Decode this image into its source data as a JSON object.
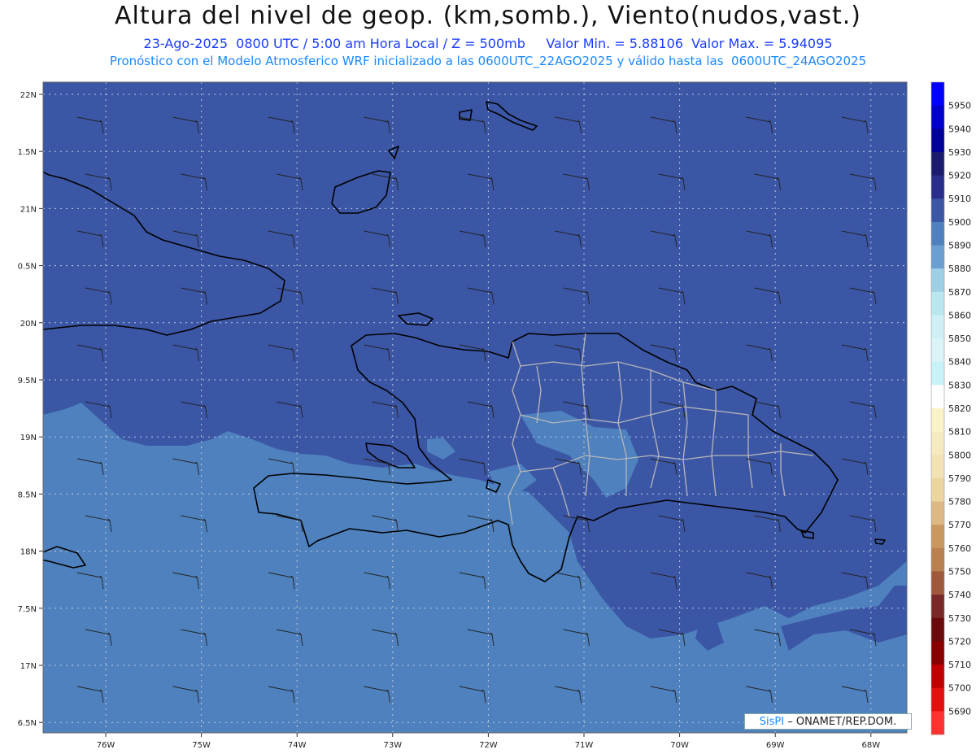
{
  "header": {
    "title": "Altura del nivel de geop. (km,somb.), Viento(nudos,vast.)",
    "date_line": "23-Ago-2025  0800 UTC / 5:00 am Hora Local / Z = 500mb     Valor Min. = 5.88106  Valor Max. = 5.94095",
    "model_line": "Pronóstico con el Modelo Atmosferico WRF inicializado a las 0600UTC_22AGO2025 y válido hasta las  0600UTC_24AGO2025"
  },
  "map": {
    "lat_labels": [
      "22N",
      "1.5N",
      "21N",
      "0.5N",
      "20N",
      "9.5N",
      "19N",
      "8.5N",
      "18N",
      "7.5N",
      "17N",
      "6.5N"
    ],
    "lon_labels": [
      "76W",
      "75W",
      "74W",
      "73W",
      "72W",
      "71W",
      "70W",
      "69W",
      "68W"
    ],
    "colors": {
      "level_5900": "#3b56a5",
      "level_5890": "#4e81bd",
      "coast": "#000000",
      "provinces": "#b8b8b8",
      "grid": "#c8d2e8"
    },
    "icons": [
      "wind-barb-icon"
    ]
  },
  "colorbar": {
    "levels": [
      "5950",
      "5940",
      "5930",
      "5920",
      "5910",
      "5900",
      "5890",
      "5880",
      "5870",
      "5860",
      "5850",
      "5840",
      "5830",
      "5820",
      "5810",
      "5800",
      "5790",
      "5780",
      "5770",
      "5760",
      "5750",
      "5740",
      "5730",
      "5720",
      "5710",
      "5700",
      "5690"
    ],
    "colors": [
      "#0000ff",
      "#0000cc",
      "#00009a",
      "#1a1a6e",
      "#282d8c",
      "#3b56a5",
      "#4e81bd",
      "#6b9fd1",
      "#9fcfe5",
      "#b9e6ef",
      "#cdeff5",
      "#dcf4f8",
      "#c8f2f8",
      "#ffffff",
      "#fbf3c8",
      "#f6ebc0",
      "#f2e2b4",
      "#ecd49e",
      "#dcb884",
      "#c89860",
      "#b98050",
      "#a0583c",
      "#7a2828",
      "#6a0a0a",
      "#8a0000",
      "#c00000",
      "#e41010",
      "#ff3030"
    ]
  },
  "credit": {
    "brand": "SisPI",
    "text": "– ONAMET/REP.DOM."
  }
}
